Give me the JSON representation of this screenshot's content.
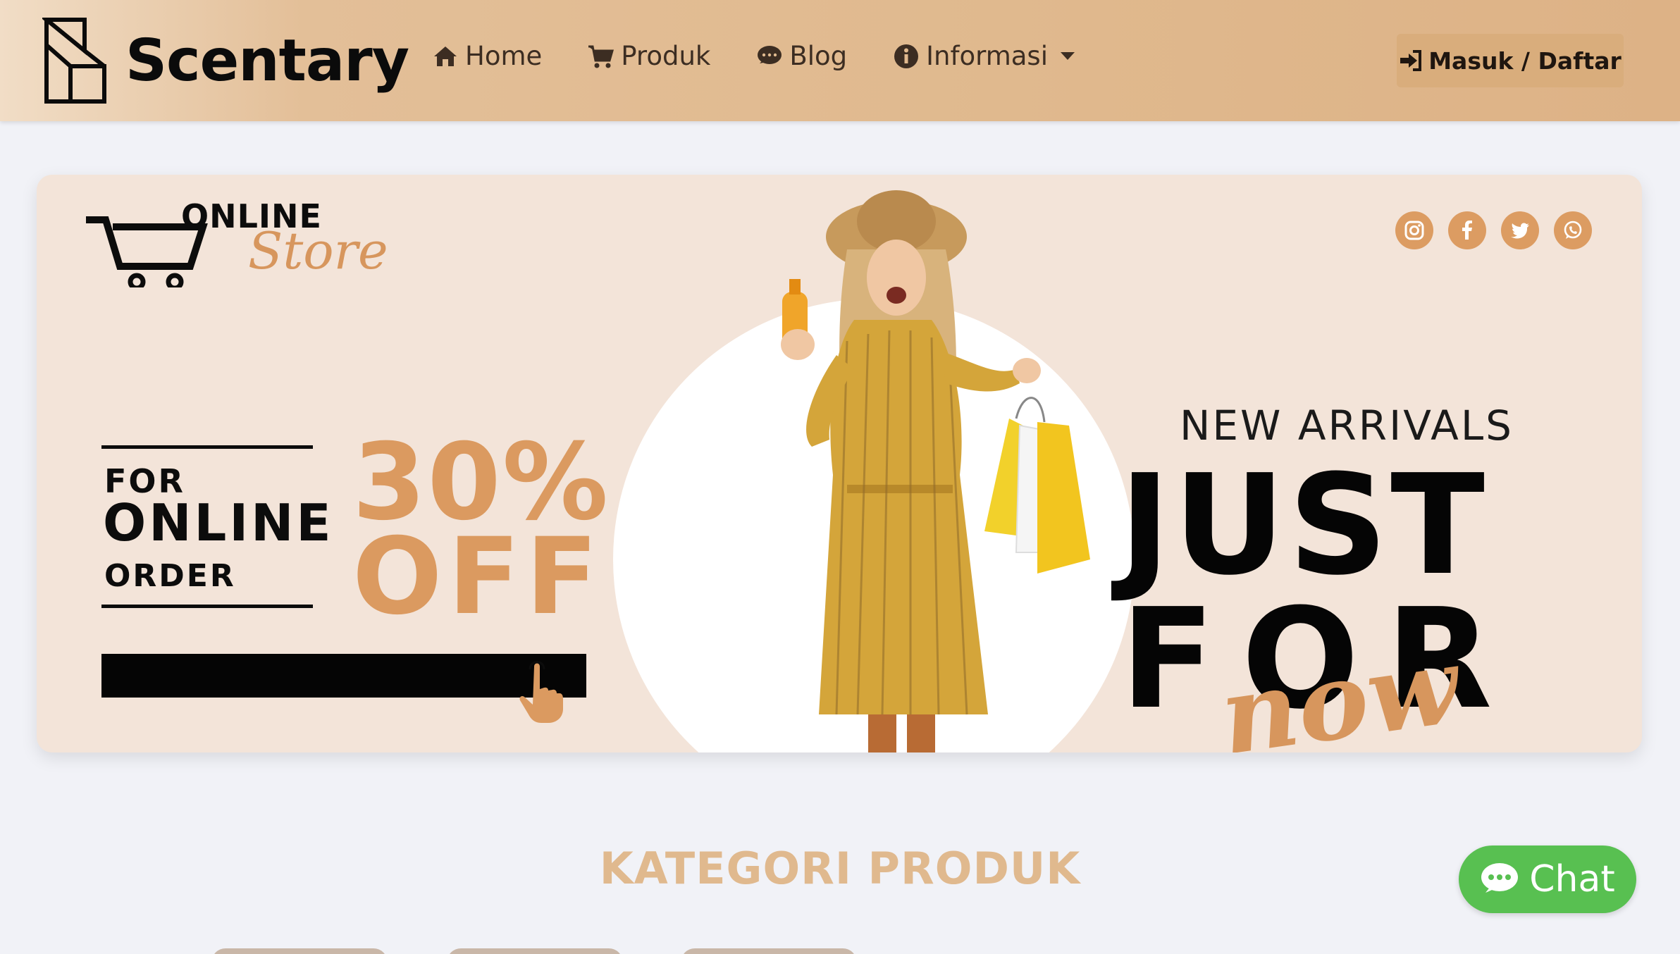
{
  "navbar": {
    "brand_name": "Scentary",
    "links": [
      {
        "label": "Home",
        "icon": "home-icon"
      },
      {
        "label": "Produk",
        "icon": "cart-icon"
      },
      {
        "label": "Blog",
        "icon": "comment-icon"
      },
      {
        "label": "Informasi",
        "icon": "info-icon"
      }
    ],
    "login_label": "Masuk / Daftar"
  },
  "banner": {
    "store_online": "ONLINE",
    "store_script": "Store",
    "offer_for": "FOR",
    "offer_online": "ONLINE",
    "offer_order": "ORDER",
    "discount_pct": "30%",
    "discount_off": "OFF",
    "new_arrivals": "NEW ARRIVALS",
    "just": "JUST",
    "for": "FOR",
    "now": "now",
    "social": [
      "instagram-icon",
      "facebook-icon",
      "twitter-icon",
      "whatsapp-icon"
    ]
  },
  "section": {
    "title": "KATEGORI PRODUK"
  },
  "chat": {
    "label": "Chat"
  },
  "colors": {
    "accent": "#e0b98e",
    "accent_dark": "#db9a60",
    "chat_green": "#58c051",
    "banner_bg": "#f3e4d9"
  }
}
